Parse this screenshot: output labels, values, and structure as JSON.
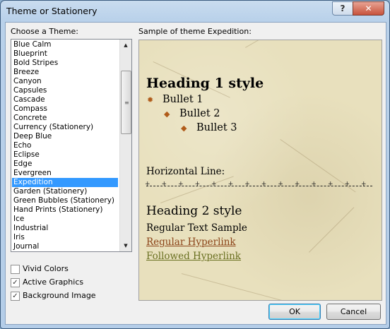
{
  "window": {
    "title": "Theme or Stationery"
  },
  "titlebar": {
    "help_glyph": "?",
    "close_glyph": "✕"
  },
  "theme_list": {
    "label": "Choose a Theme:",
    "items": [
      "Blue Calm",
      "Blueprint",
      "Bold Stripes",
      "Breeze",
      "Canyon",
      "Capsules",
      "Cascade",
      "Compass",
      "Concrete",
      "Currency (Stationery)",
      "Deep Blue",
      "Echo",
      "Eclipse",
      "Edge",
      "Evergreen",
      "Expedition",
      "Garden (Stationery)",
      "Green Bubbles (Stationery)",
      "Hand Prints (Stationery)",
      "Ice",
      "Industrial",
      "Iris",
      "Journal"
    ],
    "selected": "Expedition"
  },
  "options": {
    "vivid_colors": {
      "label": "Vivid Colors",
      "checked": false
    },
    "active_graphics": {
      "label": "Active Graphics",
      "checked": true
    },
    "background_image": {
      "label": "Background Image",
      "checked": true
    }
  },
  "preview": {
    "label": "Sample of theme Expedition:",
    "heading1": "Heading 1 style",
    "bullets": [
      "Bullet 1",
      "Bullet 2",
      "Bullet 3"
    ],
    "hr_label": "Horizontal Line:",
    "heading2": "Heading 2 style",
    "regular_text": "Regular Text Sample",
    "hyperlink": "Regular Hyperlink",
    "followed_hyperlink": "Followed Hyperlink",
    "colors": {
      "paper": "#e8e0bd",
      "hyperlink": "#8b4318",
      "followed": "#6a7021",
      "bullet": "#b05b1a"
    }
  },
  "buttons": {
    "ok": "OK",
    "cancel": "Cancel"
  },
  "icons": {
    "check": "✓",
    "scroll_up": "▲",
    "scroll_down": "▼"
  }
}
